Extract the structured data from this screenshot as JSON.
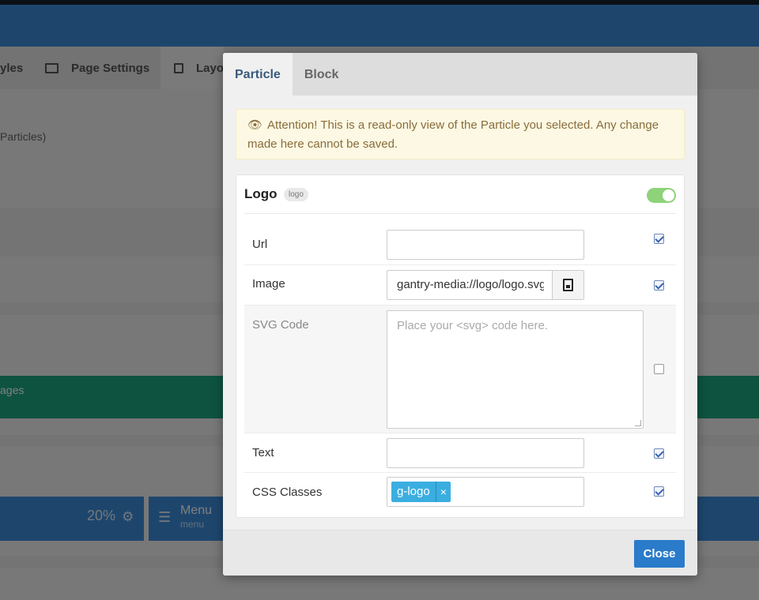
{
  "background": {
    "nav_items": [
      "yles",
      "Page Settings",
      "Layo"
    ],
    "subtitle": "Particles)",
    "green_text": "ages",
    "block_percent": "20%",
    "menu_title": "Menu",
    "menu_subtitle": "menu"
  },
  "modal": {
    "tabs": [
      {
        "label": "Particle",
        "active": true
      },
      {
        "label": "Block",
        "active": false
      }
    ],
    "alert": {
      "icon": "eye-icon",
      "text": "Attention! This is a read-only view of the Particle you selected. Any change made here cannot be saved."
    },
    "particle": {
      "title": "Logo",
      "badge": "logo",
      "enabled": true
    },
    "fields": {
      "url": {
        "label": "Url",
        "value": "",
        "override": true
      },
      "image": {
        "label": "Image",
        "value": "gantry-media://logo/logo.svg",
        "override": true
      },
      "svg_code": {
        "label": "SVG Code",
        "placeholder": "Place your <svg> code here.",
        "override": false
      },
      "text": {
        "label": "Text",
        "value": "",
        "override": true
      },
      "css_classes": {
        "label": "CSS Classes",
        "tags": [
          "g-logo"
        ],
        "remove_symbol": "×",
        "override": true
      }
    },
    "close_label": "Close"
  },
  "colors": {
    "primary": "#2a7bca",
    "header_blue": "#3c8ddb",
    "green_section": "#1ca77f",
    "toggle_on": "#8ed27a",
    "tag": "#3aaee0",
    "alert_bg": "#fcf8e3"
  }
}
